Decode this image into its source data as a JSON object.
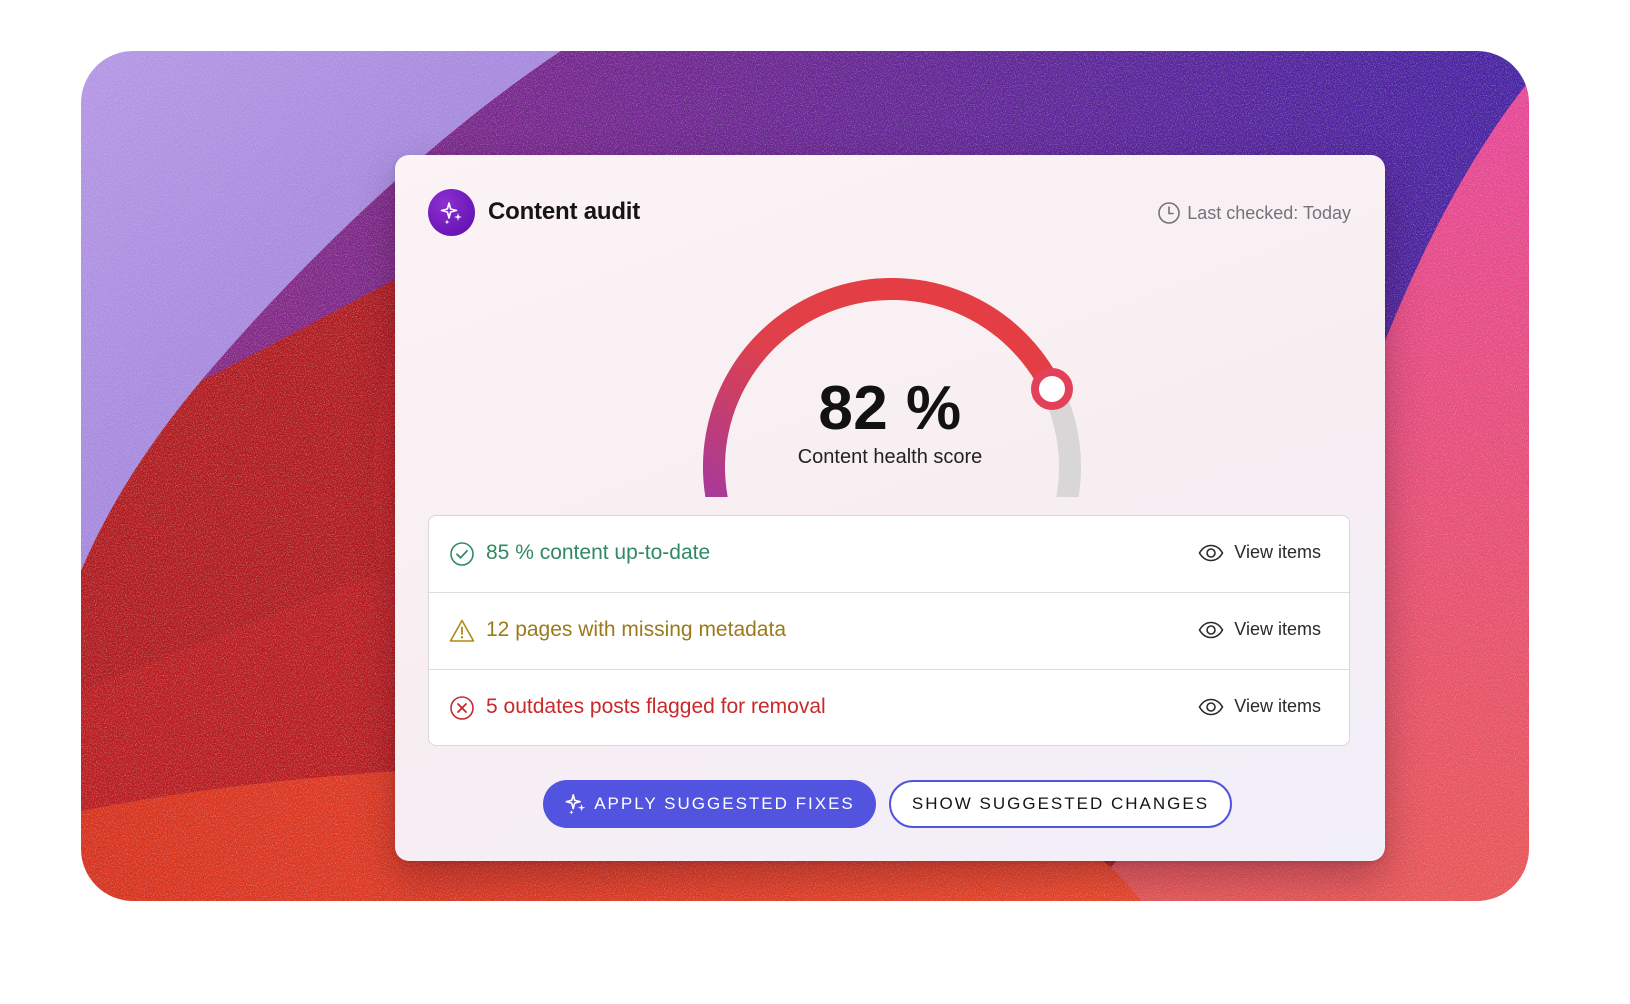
{
  "card": {
    "title": "Content audit",
    "title_icon": "sparkles-icon",
    "last_checked": "Last checked: Today",
    "last_checked_icon": "clock-icon"
  },
  "score": {
    "value_text": "82 %",
    "label": "Content health score",
    "fraction": 0.82
  },
  "items": [
    {
      "icon": "check-circle-icon",
      "text": "85 % content up-to-date",
      "action": "View items",
      "action_icon": "eye-icon",
      "color": "#2f8a63"
    },
    {
      "icon": "warning-triangle-icon",
      "text": "12 pages with missing metadata",
      "action": "View items",
      "action_icon": "eye-icon",
      "color": "#9a7a1a"
    },
    {
      "icon": "x-circle-icon",
      "text": "5 outdates posts flagged for removal",
      "action": "View items",
      "action_icon": "eye-icon",
      "color": "#c8292b"
    }
  ],
  "actions": {
    "primary": "APPLY SUGGESTED FIXES",
    "primary_icon": "sparkles-icon",
    "secondary": "SHOW SUGGESTED CHANGES"
  },
  "colors": {
    "accent": "#5254e0",
    "badge": "#6a16b8",
    "gauge_start": "#b0388c",
    "gauge_end": "#e63c40",
    "gauge_track": "#d9d6d8"
  }
}
